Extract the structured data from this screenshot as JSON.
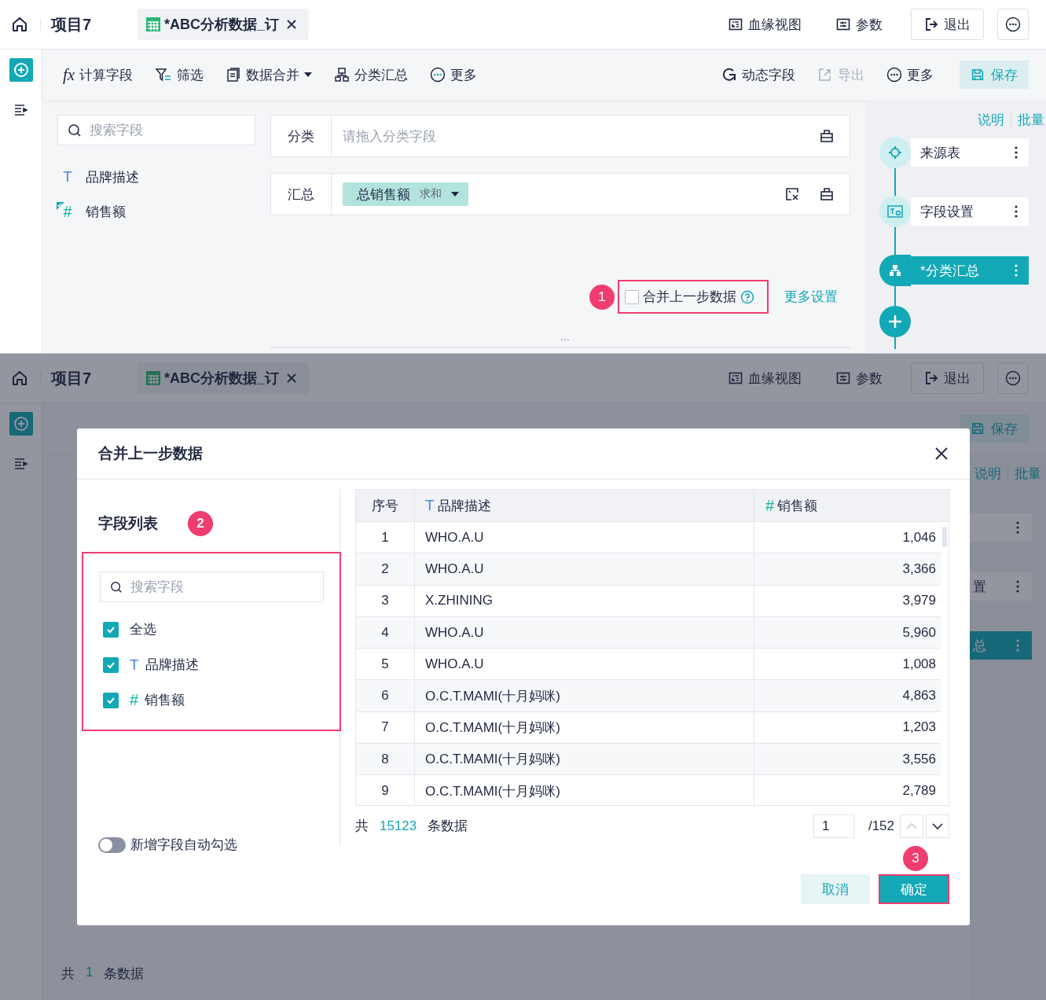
{
  "top": {
    "project": "项目7",
    "tab": {
      "title": "*ABC分析数据_订"
    },
    "header_actions": [
      {
        "label": "血缘视图",
        "kind": "lineage"
      },
      {
        "label": "参数",
        "kind": "params"
      },
      {
        "label": "退出",
        "kind": "exit"
      }
    ],
    "toolbar_left": [
      {
        "label": "计算字段",
        "kind": "formula",
        "glyph": "fx",
        "dropdown": false
      },
      {
        "label": "筛选",
        "kind": "filter",
        "dropdown": false
      },
      {
        "label": "数据合并",
        "kind": "merge",
        "dropdown": true
      },
      {
        "label": "分类汇总",
        "kind": "group",
        "dropdown": false
      },
      {
        "label": "更多",
        "kind": "more",
        "dropdown": false
      }
    ],
    "toolbar_right": [
      {
        "label": "动态字段",
        "kind": "dynamic",
        "disabled": false
      },
      {
        "label": "导出",
        "kind": "export",
        "disabled": true
      },
      {
        "label": "更多",
        "kind": "more",
        "disabled": false
      }
    ],
    "save": "保存",
    "field_search": {
      "placeholder": "搜索字段"
    },
    "fields": [
      {
        "name": "品牌描述",
        "kind": "text",
        "glyph": "T",
        "used": false
      },
      {
        "name": "销售额",
        "kind": "number",
        "glyph": "#",
        "used": true
      }
    ],
    "config_rows": [
      {
        "label": "分类",
        "kind": "drop",
        "placeholder": "请拖入分类字段"
      },
      {
        "label": "汇总",
        "kind": "chips",
        "chips": [
          {
            "name": "总销售额",
            "agg": "求和"
          }
        ]
      }
    ],
    "merge_option": {
      "label": "合并上一步数据",
      "checked": false,
      "badge": "1"
    },
    "more_settings": "更多设置",
    "step_links": [
      "说明",
      "批量"
    ],
    "steps": [
      {
        "label": "来源表",
        "kind": "source",
        "selected": false
      },
      {
        "label": "字段设置",
        "kind": "fields",
        "selected": false
      },
      {
        "label": "*分类汇总",
        "kind": "group",
        "selected": true
      }
    ]
  },
  "backdrop": {
    "project": "项目7",
    "tab": {
      "title": "*ABC分析数据_订"
    },
    "header_actions": [
      {
        "label": "血缘视图",
        "kind": "lineage"
      },
      {
        "label": "参数",
        "kind": "params"
      },
      {
        "label": "退出",
        "kind": "exit"
      }
    ],
    "save": "保存",
    "step_links": [
      "说明",
      "批量"
    ],
    "steps": [
      {
        "selected": false
      },
      {
        "visible_text": "置",
        "selected": false
      },
      {
        "visible_text": "总",
        "selected": true
      }
    ],
    "count": {
      "prefix": "共",
      "value": "1",
      "suffix": "条数据"
    }
  },
  "dialog": {
    "title": "合并上一步数据",
    "field_list_title": "字段列表",
    "badge": "2",
    "search": {
      "placeholder": "搜索字段"
    },
    "options": [
      {
        "label": "全选",
        "checked": true
      },
      {
        "label": "品牌描述",
        "kind": "text",
        "glyph": "T",
        "checked": true
      },
      {
        "label": "销售额",
        "kind": "number",
        "glyph": "#",
        "checked": true
      }
    ],
    "auto_select": {
      "label": "新增字段自动勾选",
      "on": false
    },
    "table": {
      "columns": [
        {
          "label": "序号"
        },
        {
          "label": "品牌描述",
          "kind": "text",
          "glyph": "T"
        },
        {
          "label": "销售额",
          "kind": "number",
          "glyph": "#"
        }
      ],
      "rows": [
        [
          "1",
          "WHO.A.U",
          "1,046"
        ],
        [
          "2",
          "WHO.A.U",
          "3,366"
        ],
        [
          "3",
          "X.ZHINING",
          "3,979"
        ],
        [
          "4",
          "WHO.A.U",
          "5,960"
        ],
        [
          "5",
          "WHO.A.U",
          "1,008"
        ],
        [
          "6",
          "O.C.T.MAMI(十月妈咪)",
          "4,863"
        ],
        [
          "7",
          "O.C.T.MAMI(十月妈咪)",
          "1,203"
        ],
        [
          "8",
          "O.C.T.MAMI(十月妈咪)",
          "3,556"
        ],
        [
          "9",
          "O.C.T.MAMI(十月妈咪)",
          "2,789"
        ]
      ]
    },
    "total": {
      "prefix": "共",
      "value": "15123",
      "suffix": "条数据"
    },
    "pager": {
      "page": "1",
      "pages": "/152"
    },
    "buttons": [
      {
        "label": "取消",
        "kind": "secondary"
      },
      {
        "label": "确定",
        "kind": "primary",
        "badge": "3"
      }
    ]
  }
}
